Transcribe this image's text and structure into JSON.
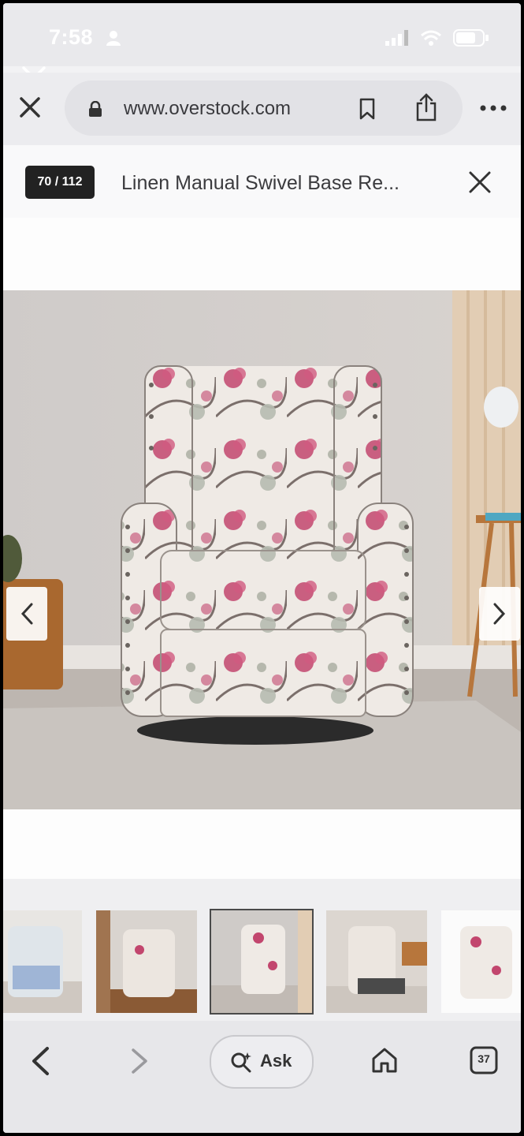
{
  "status_bar": {
    "time": "7:58",
    "signal_icon": "signal-bars-icon",
    "wifi_icon": "wifi-icon",
    "battery_icon": "battery-icon"
  },
  "browser": {
    "url": "www.overstock.com",
    "close_icon": "close-icon",
    "lock_icon": "lock-icon",
    "bookmark_icon": "bookmark-icon",
    "share_icon": "share-icon",
    "more_icon": "more-icon"
  },
  "gallery": {
    "counter": "70 / 112",
    "title": "Linen Manual Swivel Base Re...",
    "close_icon": "close-icon",
    "prev_icon": "chevron-left-icon",
    "next_icon": "chevron-right-icon"
  },
  "thumbnails": [
    {
      "label": "thumbnail-1",
      "selected": false
    },
    {
      "label": "thumbnail-2",
      "selected": false
    },
    {
      "label": "thumbnail-3",
      "selected": true
    },
    {
      "label": "thumbnail-4",
      "selected": false
    },
    {
      "label": "thumbnail-5",
      "selected": false
    }
  ],
  "bottom_nav": {
    "back_icon": "chevron-left-icon",
    "forward_icon": "chevron-right-icon",
    "ask_label": "Ask",
    "home_icon": "home-icon",
    "tabs_count": "37"
  },
  "colors": {
    "accent_pink": "#c2466e",
    "chair_fabric": "#efeae4",
    "wall": "#cfcbc8"
  }
}
